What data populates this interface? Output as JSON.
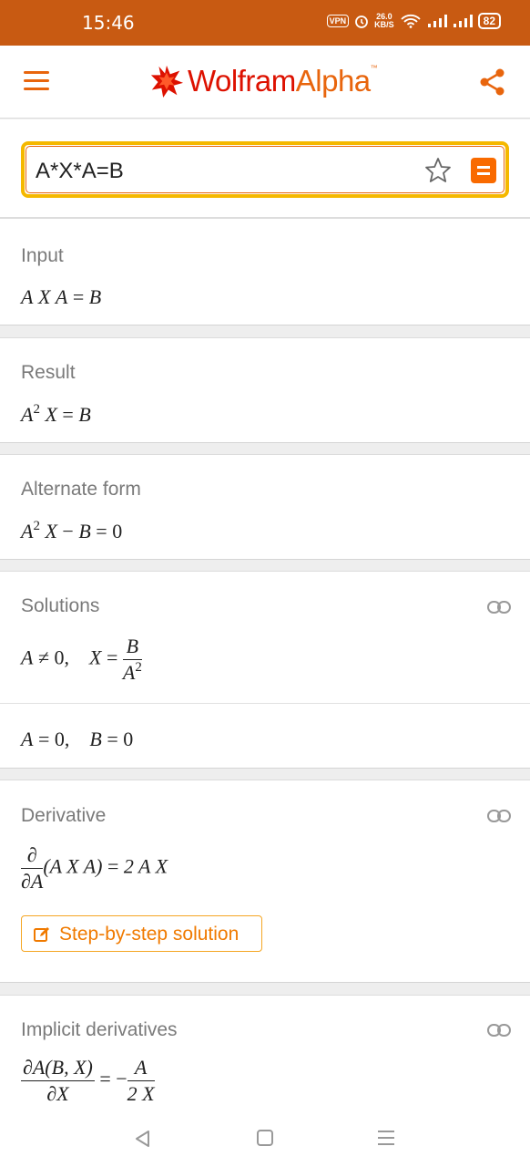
{
  "status_bar": {
    "time": "15:46",
    "vpn": "VPN",
    "speed_value": "26.0",
    "speed_unit": "KB/S",
    "wifi": "4",
    "battery": "82"
  },
  "header": {
    "logo_text_part1": "Wolfram",
    "logo_text_part2": "Alpha",
    "logo_tm": "™",
    "accent_color": "#e8650d"
  },
  "search": {
    "query": "A*X*A=B"
  },
  "pods": {
    "input": {
      "title": "Input",
      "A1": "A",
      "X": "X",
      "A2": "A",
      "eq": "=",
      "B": "B"
    },
    "result": {
      "title": "Result",
      "A": "A",
      "exp": "2",
      "X": "X",
      "eq": "=",
      "B": "B"
    },
    "alternate": {
      "title": "Alternate form",
      "A": "A",
      "exp": "2",
      "X": "X",
      "minus": "−",
      "B": "B",
      "eq": "=",
      "zero": "0"
    },
    "solutions": {
      "title": "Solutions",
      "sol1": {
        "A": "A",
        "neq": "≠",
        "zero": "0",
        "comma": ",",
        "X": "X",
        "eq": "=",
        "num": "B",
        "den_A": "A",
        "den_exp": "2"
      },
      "sol2": {
        "A": "A",
        "eq1": "=",
        "zero1": "0",
        "comma": ",",
        "B": "B",
        "eq2": "=",
        "zero2": "0"
      }
    },
    "derivative": {
      "title": "Derivative",
      "num": "∂",
      "den": "∂A",
      "expr": "(A X A)",
      "eq": "=",
      "rhs": "2 A X",
      "step_label": "Step-by-step solution"
    },
    "implicit": {
      "title": "Implicit derivatives",
      "lhs_num": "∂A(B, X)",
      "lhs_den": "∂X",
      "eq": "= −",
      "rhs_num": "A",
      "rhs_den": "2 X"
    }
  },
  "nav": {
    "back_icon": "triangle-back",
    "home_icon": "square-home",
    "menu_icon": "three-lines-menu"
  }
}
